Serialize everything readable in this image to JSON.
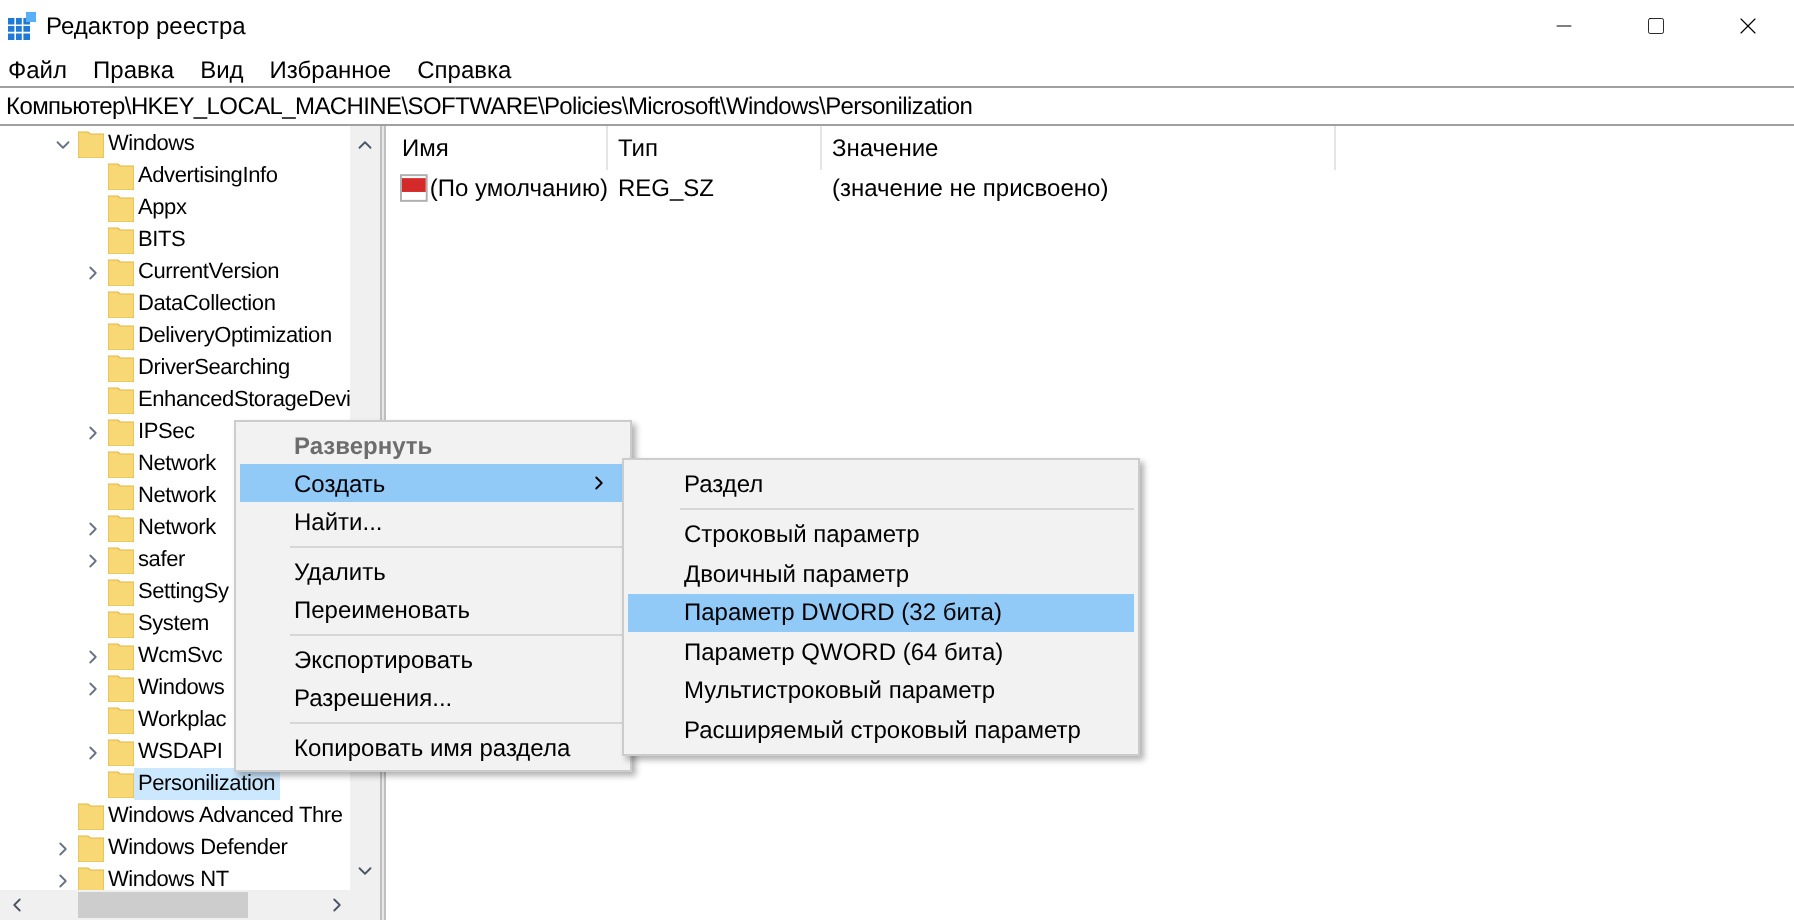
{
  "window": {
    "title": "Редактор реестра"
  },
  "menu_bar": [
    "Файл",
    "Правка",
    "Вид",
    "Избранное",
    "Справка"
  ],
  "address_bar": {
    "value": "Компьютер\\HKEY_LOCAL_MACHINE\\SOFTWARE\\Policies\\Microsoft\\Windows\\Personilization"
  },
  "tree": [
    {
      "label": "Windows",
      "has_children": true,
      "expanded": true,
      "selected": false,
      "children": [
        {
          "label": "AdvertisingInfo",
          "has_children": false,
          "selected": false
        },
        {
          "label": "Appx",
          "has_children": false,
          "selected": false
        },
        {
          "label": "BITS",
          "has_children": false,
          "selected": false
        },
        {
          "label": "CurrentVersion",
          "has_children": true,
          "expanded": false,
          "selected": false
        },
        {
          "label": "DataCollection",
          "has_children": false,
          "selected": false
        },
        {
          "label": "DeliveryOptimization",
          "has_children": false,
          "selected": false
        },
        {
          "label": "DriverSearching",
          "has_children": false,
          "selected": false
        },
        {
          "label": "EnhancedStorageDevi",
          "has_children": false,
          "selected": false
        },
        {
          "label": "IPSec",
          "has_children": true,
          "expanded": false,
          "selected": false
        },
        {
          "label": "Network",
          "has_children": false,
          "selected": false
        },
        {
          "label": "Network",
          "has_children": false,
          "selected": false
        },
        {
          "label": "Network",
          "has_children": true,
          "expanded": false,
          "selected": false
        },
        {
          "label": "safer",
          "has_children": true,
          "expanded": false,
          "selected": false
        },
        {
          "label": "SettingSy",
          "has_children": false,
          "selected": false
        },
        {
          "label": "System",
          "has_children": false,
          "selected": false
        },
        {
          "label": "WcmSvc",
          "has_children": true,
          "expanded": false,
          "selected": false
        },
        {
          "label": "Windows",
          "has_children": true,
          "expanded": false,
          "selected": false
        },
        {
          "label": "Workplac",
          "has_children": false,
          "selected": false
        },
        {
          "label": "WSDAPI",
          "has_children": true,
          "expanded": false,
          "selected": false
        },
        {
          "label": "Personilization",
          "has_children": false,
          "selected": true
        }
      ]
    },
    {
      "label": "Windows Advanced Thre",
      "has_children": false,
      "selected": false
    },
    {
      "label": "Windows Defender",
      "has_children": true,
      "expanded": false,
      "selected": false
    },
    {
      "label": "Windows NT",
      "has_children": true,
      "expanded": false,
      "selected": false
    }
  ],
  "table": {
    "columns": [
      "Имя",
      "Тип",
      "Значение"
    ],
    "rows": [
      {
        "name": "(По умолчанию)",
        "type": "REG_SZ",
        "value": "(значение не присвоено)"
      }
    ]
  },
  "context_menu": [
    {
      "kind": "item",
      "label": "Развернуть",
      "disabled": true,
      "selected": false,
      "has_submenu": false
    },
    {
      "kind": "item",
      "label": "Создать",
      "disabled": false,
      "selected": true,
      "has_submenu": true
    },
    {
      "kind": "item",
      "label": "Найти...",
      "disabled": false,
      "selected": false,
      "has_submenu": false
    },
    {
      "kind": "separator"
    },
    {
      "kind": "item",
      "label": "Удалить",
      "disabled": false,
      "selected": false,
      "has_submenu": false
    },
    {
      "kind": "item",
      "label": "Переименовать",
      "disabled": false,
      "selected": false,
      "has_submenu": false
    },
    {
      "kind": "separator"
    },
    {
      "kind": "item",
      "label": "Экспортировать",
      "disabled": false,
      "selected": false,
      "has_submenu": false
    },
    {
      "kind": "item",
      "label": "Разрешения...",
      "disabled": false,
      "selected": false,
      "has_submenu": false
    },
    {
      "kind": "separator"
    },
    {
      "kind": "item",
      "label": "Копировать имя раздела",
      "disabled": false,
      "selected": false,
      "has_submenu": false
    }
  ],
  "submenu": [
    {
      "kind": "item",
      "label": "Раздел",
      "disabled": false,
      "selected": false,
      "has_submenu": false
    },
    {
      "kind": "separator"
    },
    {
      "kind": "item",
      "label": "Строковый параметр",
      "disabled": false,
      "selected": false,
      "has_submenu": false
    },
    {
      "kind": "item",
      "label": "Двоичный параметр",
      "disabled": false,
      "selected": false,
      "has_submenu": false
    },
    {
      "kind": "item",
      "label": "Параметр DWORD (32 бита)",
      "disabled": false,
      "selected": true,
      "has_submenu": false
    },
    {
      "kind": "item",
      "label": "Параметр QWORD (64 бита)",
      "disabled": false,
      "selected": false,
      "has_submenu": false
    },
    {
      "kind": "item",
      "label": "Мультистроковый параметр",
      "disabled": false,
      "selected": false,
      "has_submenu": false
    },
    {
      "kind": "item",
      "label": "Расширяемый строковый параметр",
      "disabled": false,
      "selected": false,
      "has_submenu": false
    }
  ]
}
